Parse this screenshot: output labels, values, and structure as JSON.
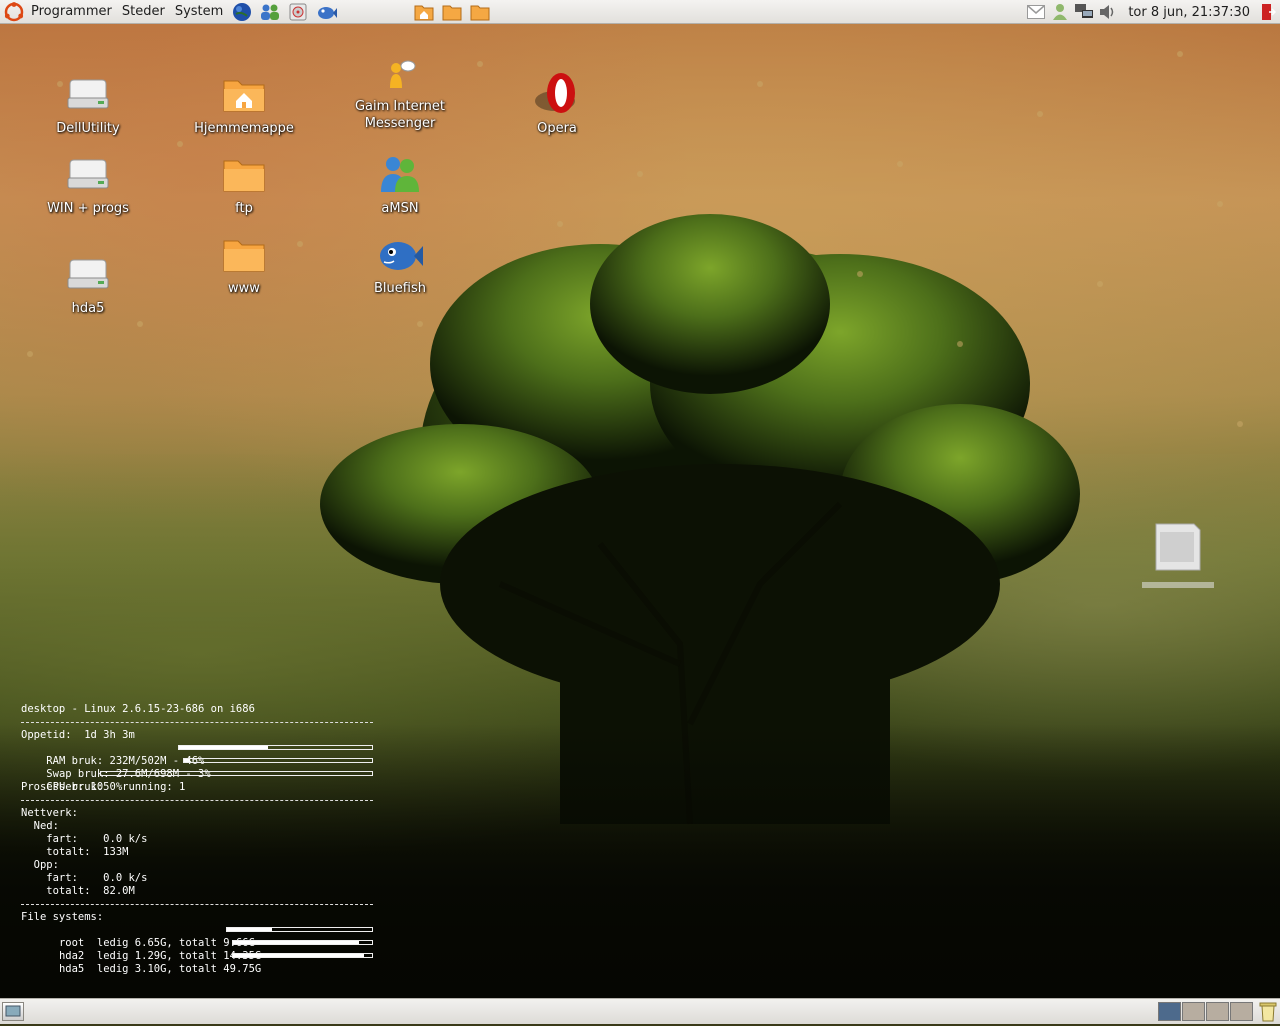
{
  "top_panel": {
    "menus": [
      "Programmer",
      "Steder",
      "System"
    ],
    "launchers": [
      "globe-icon",
      "people-icon",
      "media-icon",
      "fish-icon",
      "home-folder-icon",
      "folder-icon",
      "folder-icon"
    ],
    "tray_icons": [
      "gmail-icon",
      "update-icon",
      "network-icon",
      "volume-icon"
    ],
    "clock": "tor  8 jun, 21:37:30"
  },
  "desktop_icons": [
    {
      "label": "DellUtility",
      "icon": "drive-icon"
    },
    {
      "label": "WIN + progs",
      "icon": "drive-icon"
    },
    {
      "label": "hda5",
      "icon": "drive-icon"
    },
    {
      "label": "Hjemmemappe",
      "icon": "home-folder-icon"
    },
    {
      "label": "ftp",
      "icon": "folder-icon"
    },
    {
      "label": "www",
      "icon": "folder-icon"
    },
    {
      "label": "Gaim Internet Messenger",
      "icon": "gaim-icon"
    },
    {
      "label": "aMSN",
      "icon": "amsn-icon"
    },
    {
      "label": "Bluefish",
      "icon": "bluefish-icon"
    },
    {
      "label": "Opera",
      "icon": "opera-icon"
    }
  ],
  "conky": {
    "header": "desktop - Linux 2.6.15-23-686 on i686",
    "uptime": "Oppetid:  1d 3h 3m",
    "ram": "RAM bruk: 232M/502M - 46%",
    "ram_fraction": 0.46,
    "swap": "Swap bruk: 27.6M/698M - 3%",
    "swap_fraction": 0.03,
    "cpu": "CPU bruk: 0%",
    "cpu_fraction": 0.0,
    "processes": "Prosesser: 105  running: 1",
    "network_title": "Nettverk:",
    "down_title": "  Ned:",
    "down_speed": "    fart:    0.0 k/s",
    "down_total": "    totalt:  133M",
    "up_title": "  Opp:",
    "up_speed": "    fart:    0.0 k/s",
    "up_total": "    totalt:  82.0M",
    "fs_title": "File systems:",
    "fs": [
      {
        "text": "  root  ledig 6.65G, totalt 9.66G",
        "used_fraction": 0.31
      },
      {
        "text": "  hda2  ledig 1.29G, totalt 14.35G",
        "used_fraction": 0.91
      },
      {
        "text": "  hda5  ledig 3.10G, totalt 49.75G",
        "used_fraction": 0.94
      }
    ]
  },
  "bottom_panel": {
    "workspace_count": 4,
    "active_workspace": 1
  },
  "colors": {
    "panel_bg": "#e9e7e3",
    "folder_orange": "#f7a540",
    "text_white": "#ffffff",
    "workspace_active": "#4d6a8c",
    "workspace_inactive": "#b7ada0"
  }
}
